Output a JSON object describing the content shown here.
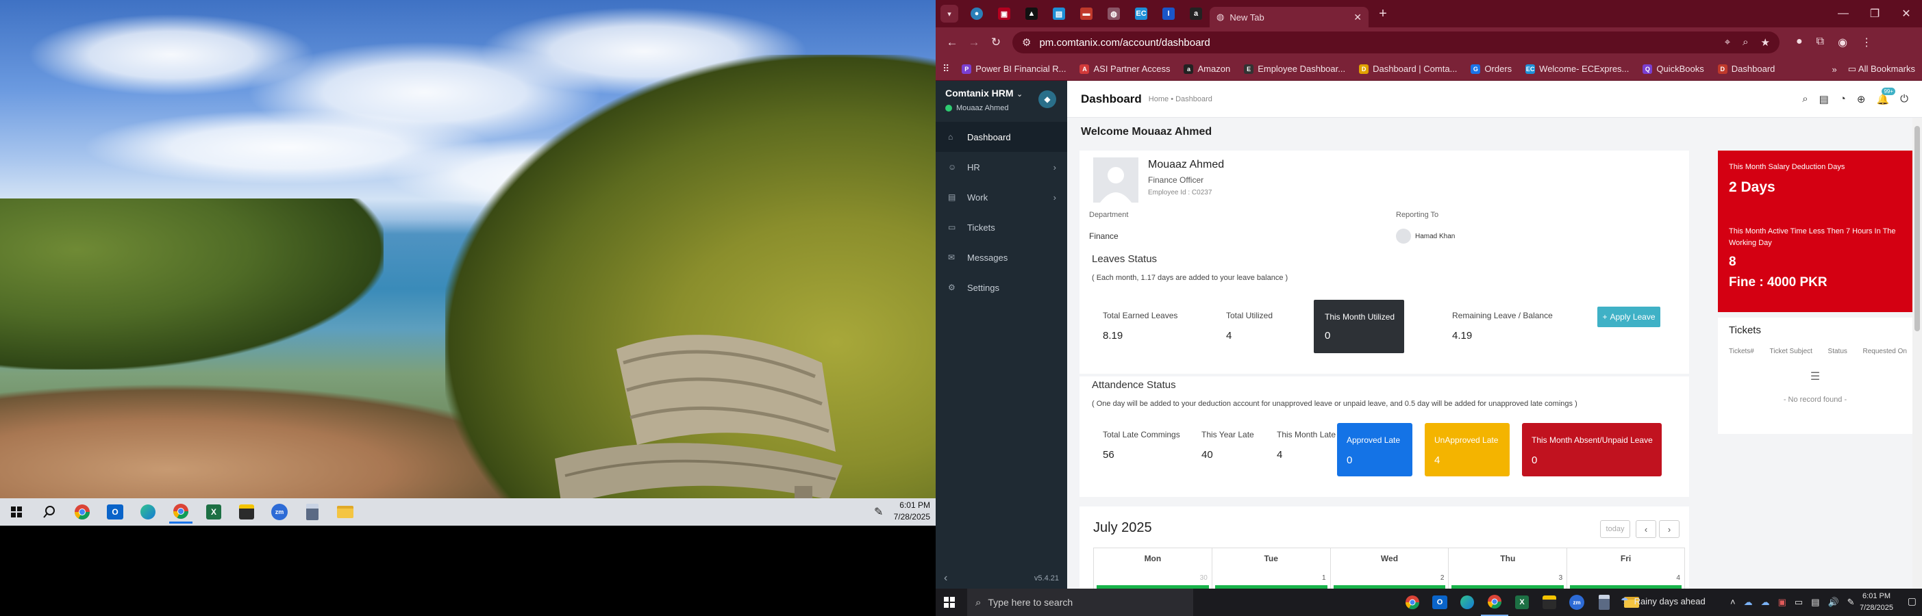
{
  "left_clock": {
    "time": "6:01 PM",
    "date": "7/28/2025"
  },
  "browser": {
    "active_tab_title": "New Tab",
    "url": "pm.comtanix.com/account/dashboard",
    "bookmarks": [
      {
        "label": "Power BI Financial R...",
        "color": "#7a3fd1",
        "glyph": "P"
      },
      {
        "label": "ASI Partner Access",
        "color": "#d23a3a",
        "glyph": "A"
      },
      {
        "label": "Amazon",
        "color": "#222222",
        "glyph": "a"
      },
      {
        "label": "Employee Dashboar...",
        "color": "#333333",
        "glyph": "E"
      },
      {
        "label": "Dashboard | Comta...",
        "color": "#e0a100",
        "glyph": "D"
      },
      {
        "label": "Orders",
        "color": "#1a73e8",
        "glyph": "G"
      },
      {
        "label": "Welcome- ECExpres...",
        "color": "#1f8fd6",
        "glyph": "EC"
      },
      {
        "label": "QuickBooks",
        "color": "#7a3fd1",
        "glyph": "Q"
      },
      {
        "label": "Dashboard",
        "color": "#c0392b",
        "glyph": "D"
      }
    ],
    "all_bookmarks": "All Bookmarks"
  },
  "sidebar": {
    "brand": "Comtanix HRM",
    "user": "Mouaaz Ahmed",
    "items": [
      {
        "label": "Dashboard",
        "icon": "home-icon"
      },
      {
        "label": "HR",
        "icon": "users-icon"
      },
      {
        "label": "Work",
        "icon": "briefcase-icon"
      },
      {
        "label": "Tickets",
        "icon": "ticket-icon"
      },
      {
        "label": "Messages",
        "icon": "message-icon"
      },
      {
        "label": "Settings",
        "icon": "gear-icon"
      }
    ],
    "version": "v5.4.21"
  },
  "header": {
    "title": "Dashboard",
    "breadcrumb_home": "Home",
    "breadcrumb_current": "Dashboard",
    "notif_count": "99+"
  },
  "welcome": "Welcome Mouaaz Ahmed",
  "profile": {
    "name": "Mouaaz Ahmed",
    "role": "Finance Officer",
    "employee_id": "Employee Id : C0237",
    "department_label": "Department",
    "department": "Finance",
    "reporting_label": "Reporting To",
    "reporting_to": "Hamad Khan"
  },
  "leaves": {
    "title": "Leaves Status",
    "note": "( Each month, 1.17 days are added to your leave balance )",
    "earned_label": "Total Earned Leaves",
    "earned": "8.19",
    "utilized_label": "Total Utilized",
    "utilized": "4",
    "month_label": "This Month Utilized",
    "month": "0",
    "remaining_label": "Remaining Leave / Balance",
    "remaining": "4.19",
    "apply": "Apply Leave"
  },
  "attendance": {
    "title": "Attandence Status",
    "note": "( One day will be added to your deduction account for unapproved leave or unpaid leave, and 0.5 day will be added for unapproved late comings )",
    "late_label": "Total Late Commings",
    "late": "56",
    "year_label": "This Year Late",
    "year": "40",
    "month_label": "This Month Late",
    "month": "4",
    "approved_label": "Approved Late",
    "approved": "0",
    "unapproved_label": "UnApproved Late",
    "unapproved": "4",
    "absent_label": "This Month Absent/Unpaid Leave",
    "absent": "0",
    "colors": {
      "approved": "#1473e6",
      "unapproved": "#f4b400",
      "absent": "#c1121f"
    }
  },
  "calendar": {
    "title": "July 2025",
    "today": "today",
    "days": [
      {
        "name": "Mon",
        "num": "30"
      },
      {
        "name": "Tue",
        "num": "1"
      },
      {
        "name": "Wed",
        "num": "2"
      },
      {
        "name": "Thu",
        "num": "3"
      },
      {
        "name": "Fri",
        "num": "4"
      }
    ]
  },
  "salary": {
    "deduction_label": "This Month Salary Deduction Days",
    "deduction": "2 Days",
    "active_label": "This Month Active Time Less Then 7 Hours In The Working Day",
    "active": "8",
    "fine": "Fine : 4000 PKR"
  },
  "tickets": {
    "title": "Tickets",
    "cols": [
      "Tickets#",
      "Ticket Subject",
      "Status",
      "Requested On"
    ],
    "empty": "- No record found -"
  },
  "right_taskbar": {
    "search": "Type here to search",
    "weather": "Rainy days ahead",
    "time": "6:01 PM",
    "date": "7/28/2025"
  }
}
